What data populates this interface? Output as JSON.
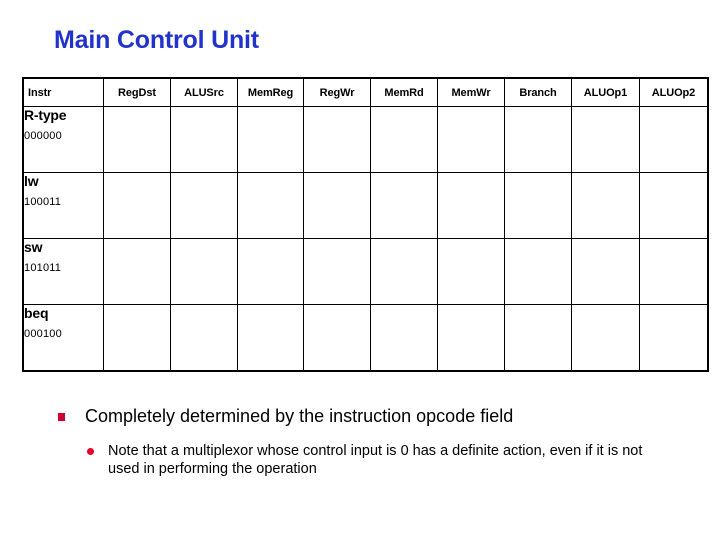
{
  "slide": {
    "title": "Main Control Unit",
    "title_color": "#2233CC"
  },
  "table": {
    "columns": [
      "Instr",
      "RegDst",
      "ALUSrc",
      "MemReg",
      "RegWr",
      "MemRd",
      "MemWr",
      "Branch",
      "ALUOp1",
      "ALUOp2"
    ],
    "rows": [
      {
        "instr": "R-type",
        "opcode": "000000",
        "signals": [
          "",
          "",
          "",
          "",
          "",
          "",
          "",
          "",
          ""
        ]
      },
      {
        "instr": "lw",
        "opcode": "100011",
        "signals": [
          "",
          "",
          "",
          "",
          "",
          "",
          "",
          "",
          ""
        ]
      },
      {
        "instr": "sw",
        "opcode": "101011",
        "signals": [
          "",
          "",
          "",
          "",
          "",
          "",
          "",
          "",
          ""
        ]
      },
      {
        "instr": "beq",
        "opcode": "000100",
        "signals": [
          "",
          "",
          "",
          "",
          "",
          "",
          "",
          "",
          ""
        ]
      }
    ]
  },
  "bullets": {
    "level1": {
      "marker": "square-bullet-icon",
      "marker_color": "#CC0033",
      "text": "Completely determined by the instruction opcode field"
    },
    "level2": {
      "marker": "disc-bullet-icon",
      "marker_color": "#E8002A",
      "text": "Note that a multiplexor whose control input is 0 has a definite action, even if it is not used in performing the operation"
    }
  }
}
